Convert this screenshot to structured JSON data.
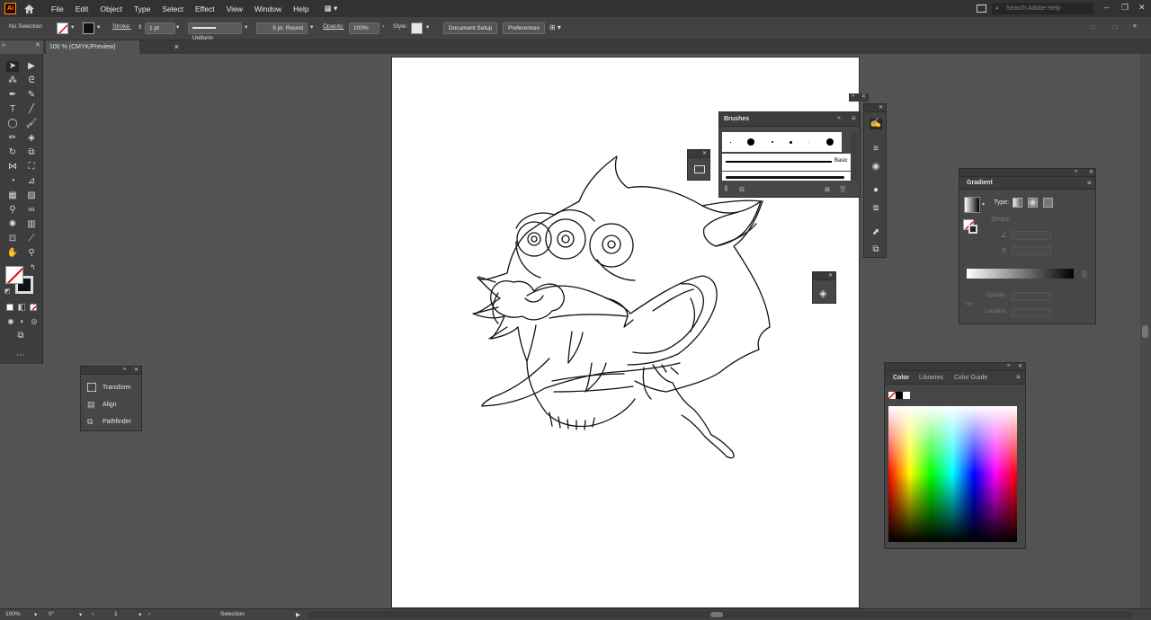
{
  "app": {
    "logo": "Ai"
  },
  "menu": [
    "File",
    "Edit",
    "Object",
    "Type",
    "Select",
    "Effect",
    "View",
    "Window",
    "Help"
  ],
  "search": {
    "placeholder": "Search Adobe Help"
  },
  "control": {
    "selection": "No Selection",
    "stroke_label": "Stroke:",
    "stroke_weight": "1 pt",
    "profile": "Uniform",
    "brush": "5 pt. Round",
    "opacity_label": "Opacity:",
    "opacity": "100%",
    "style_label": "Style:",
    "document_setup": "Document Setup",
    "preferences": "Preferences"
  },
  "document_tab": {
    "title": "100 % (CMYK/Preview)",
    "close": "×"
  },
  "panels": {
    "brushes": {
      "title": "Brushes",
      "basic": "Basic"
    },
    "gradient": {
      "title": "Gradient",
      "type_label": "Type:",
      "stroke_label": "Stroke:",
      "opacity_label": "Opacity:",
      "location_label": "Location:"
    },
    "color": {
      "tabs": [
        "Color",
        "Libraries",
        "Color Guide"
      ]
    },
    "properties_mini": {
      "items": [
        "Transform",
        "Align",
        "Pathfinder"
      ]
    }
  },
  "status": {
    "zoom": "100%",
    "rotation": "0°",
    "artboard": "1",
    "tool": "Selection"
  },
  "colors": {
    "accent": "#ff9a00",
    "canvas": "#535353",
    "artboard": "#ffffff"
  }
}
